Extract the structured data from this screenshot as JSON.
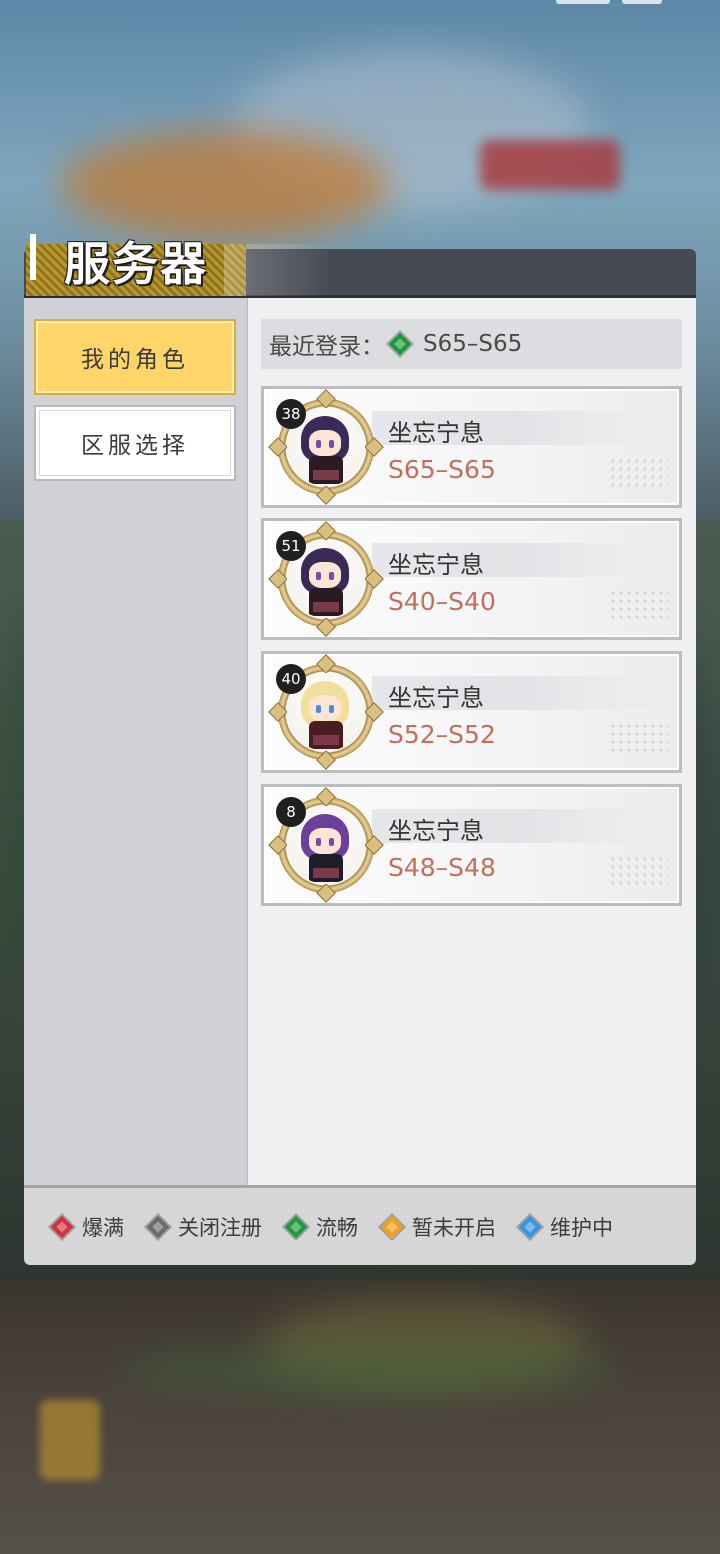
{
  "panel": {
    "title": "服务器"
  },
  "tabs": [
    {
      "label": "我的角色",
      "active": true
    },
    {
      "label": "区服选择",
      "active": false
    }
  ],
  "recent_login": {
    "label": "最近登录：",
    "server": "S65–S65",
    "status_color": "#1e9b3c"
  },
  "characters": [
    {
      "level": "38",
      "name": "坐忘宁息",
      "server": "S65–S65",
      "hair_color": "#3b2a57",
      "outfit_color": "#2a1b22"
    },
    {
      "level": "51",
      "name": "坐忘宁息",
      "server": "S40–S40",
      "hair_color": "#3b2a57",
      "outfit_color": "#2a1b22"
    },
    {
      "level": "40",
      "name": "坐忘宁息",
      "server": "S52–S52",
      "hair_color": "#f2df9a",
      "outfit_color": "#4a1c22"
    },
    {
      "level": "8",
      "name": "坐忘宁息",
      "server": "S48–S48",
      "hair_color": "#6b3f9a",
      "outfit_color": "#1d1d2a"
    }
  ],
  "legend": [
    {
      "label": "爆满",
      "color": "#d2323a",
      "icon": "red-diamond-icon"
    },
    {
      "label": "关闭注册",
      "color": "#6b6b6b",
      "icon": "gray-diamond-icon"
    },
    {
      "label": "流畅",
      "color": "#1e9b3c",
      "icon": "green-diamond-icon"
    },
    {
      "label": "暂未开启",
      "color": "#f2a020",
      "icon": "orange-diamond-icon"
    },
    {
      "label": "维护中",
      "color": "#3a95e0",
      "icon": "blue-diamond-icon"
    }
  ],
  "colors": {
    "server_text": "#c0705a",
    "tab_active": "#ffd56a"
  }
}
